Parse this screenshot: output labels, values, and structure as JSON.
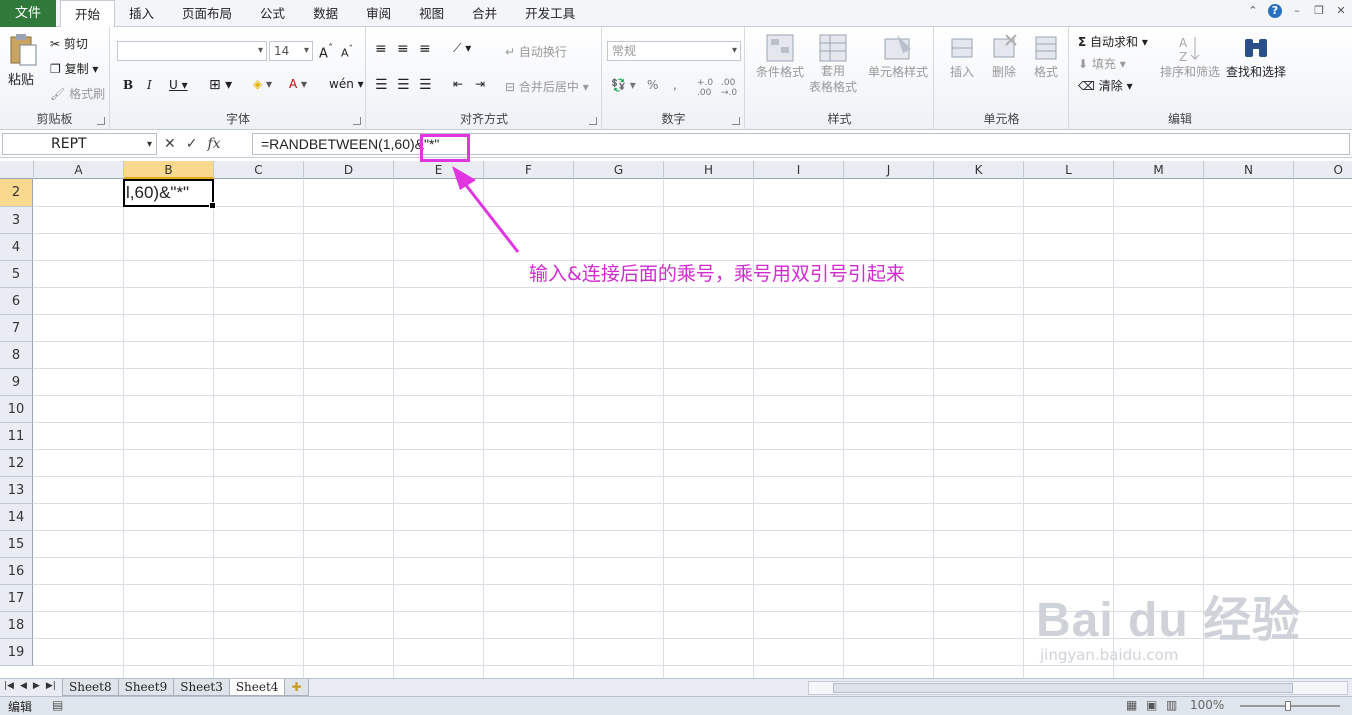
{
  "menu": {
    "file_label": "文件",
    "tabs": [
      "开始",
      "插入",
      "页面布局",
      "公式",
      "数据",
      "审阅",
      "视图",
      "合并",
      "开发工具"
    ]
  },
  "ribbon": {
    "clipboard": {
      "paste": "粘贴",
      "cut": "剪切",
      "copy": "复制",
      "format_painter": "格式刷",
      "label": "剪贴板"
    },
    "font": {
      "size": "14",
      "label": "字体"
    },
    "alignment": {
      "wrap": "自动换行",
      "merge": "合并后居中",
      "label": "对齐方式"
    },
    "number": {
      "format": "常规",
      "label": "数字"
    },
    "styles": {
      "conditional": "条件格式",
      "table_line1": "套用",
      "table_line2": "表格格式",
      "cell_styles": "单元格样式",
      "label": "样式"
    },
    "cells": {
      "insert": "插入",
      "delete": "删除",
      "format": "格式",
      "label": "单元格"
    },
    "editing": {
      "autosum": "自动求和",
      "fill": "填充",
      "clear": "清除",
      "sort": "排序和筛选",
      "find": "查找和选择",
      "label": "编辑"
    }
  },
  "formula_bar": {
    "name_box": "REPT",
    "formula": "=RANDBETWEEN(1,60)&\"*\""
  },
  "grid": {
    "columns": [
      "A",
      "B",
      "C",
      "D",
      "E",
      "F",
      "G",
      "H",
      "I",
      "J",
      "K",
      "L",
      "M",
      "N",
      "O"
    ],
    "rows": [
      "2",
      "3",
      "4",
      "5",
      "6",
      "7",
      "8",
      "9",
      "10",
      "11",
      "12",
      "13",
      "14",
      "15",
      "16",
      "17",
      "18",
      "19"
    ],
    "active_cell_text": "l,60)&\"*\""
  },
  "annotation": {
    "text": "输入&连接后面的乘号，乘号用双引号引起来"
  },
  "watermark": {
    "main": "Bai du 经验",
    "sub": "jingyan.baidu.com"
  },
  "sheets": {
    "tabs": [
      "Sheet8",
      "Sheet9",
      "Sheet3",
      "Sheet4"
    ],
    "active": "Sheet4"
  },
  "status": {
    "mode": "编辑",
    "zoom": "100%"
  },
  "colors": {
    "file_tab": "#2f7a3b",
    "annotation": "#e035e0",
    "selection_header": "#f9d98e"
  }
}
